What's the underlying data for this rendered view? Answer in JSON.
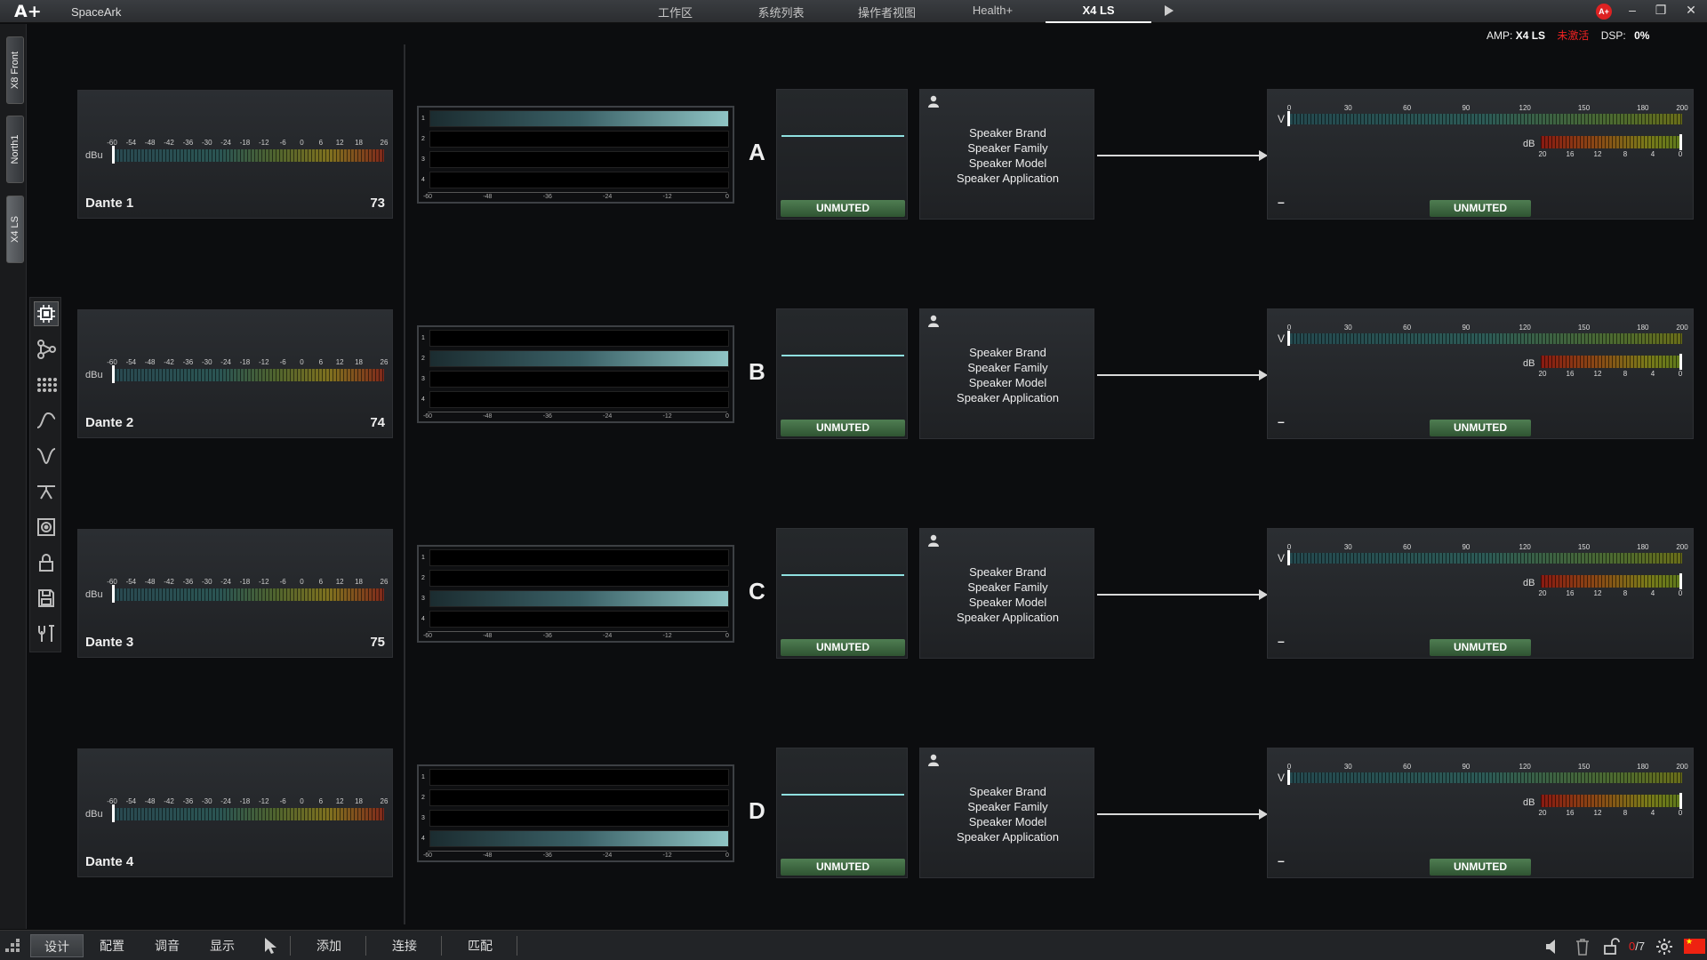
{
  "app": {
    "logo": "A+",
    "name": "SpaceArk"
  },
  "tabs": [
    "工作区",
    "系统列表",
    "操作者视图",
    "Health+",
    "X4 LS"
  ],
  "active_tab": "X4 LS",
  "brand_badge": "A+",
  "window_controls": {
    "minimize": "–",
    "restore": "❐",
    "close": "✕"
  },
  "amp_status": {
    "amp_label": "AMP:",
    "amp_value": "X4 LS",
    "activation": "未激活",
    "dsp_label": "DSP:",
    "dsp_value": "0%"
  },
  "device_tabs": [
    "X8 Front",
    "North1",
    "X4 LS"
  ],
  "tools": [
    "chip-icon",
    "routing-icon",
    "grid-icon",
    "curve-icon",
    "eq-icon",
    "filter-icon",
    "speaker-icon",
    "lock-icon",
    "save-icon",
    "tools-icon"
  ],
  "input_scale": [
    "-60",
    "-54",
    "-48",
    "-42",
    "-36",
    "-30",
    "-24",
    "-18",
    "-12",
    "-6",
    "0",
    "6",
    "12",
    "18",
    "26"
  ],
  "input_unit": "dBu",
  "matrix_scale": [
    "-60",
    "-48",
    "-36",
    "-24",
    "-12",
    "0"
  ],
  "matrix_rows": [
    "1",
    "2",
    "3",
    "4"
  ],
  "volt_unit": "V",
  "volt_scale": [
    "0",
    "30",
    "60",
    "90",
    "120",
    "150",
    "180",
    "200"
  ],
  "db_unit": "dB",
  "db_scale": [
    "20",
    "16",
    "12",
    "8",
    "4",
    "0"
  ],
  "speaker_lines": [
    "Speaker Brand",
    "Speaker Family",
    "Speaker Model",
    "Speaker Application"
  ],
  "channels": [
    {
      "input_name": "Dante 1",
      "input_number": "73",
      "letter": "A",
      "active_route": 1,
      "mute_state": "UNMUTED",
      "out_state": "UNMUTED",
      "out_minus": "–"
    },
    {
      "input_name": "Dante 2",
      "input_number": "74",
      "letter": "B",
      "active_route": 2,
      "mute_state": "UNMUTED",
      "out_state": "UNMUTED",
      "out_minus": "–"
    },
    {
      "input_name": "Dante 3",
      "input_number": "75",
      "letter": "C",
      "active_route": 3,
      "mute_state": "UNMUTED",
      "out_state": "UNMUTED",
      "out_minus": "–"
    },
    {
      "input_name": "Dante 4",
      "input_number": "",
      "letter": "D",
      "active_route": 4,
      "mute_state": "UNMUTED",
      "out_state": "UNMUTED",
      "out_minus": "–"
    }
  ],
  "bottom": {
    "modes": [
      "设计",
      "配置",
      "调音",
      "显示"
    ],
    "active_mode": "设计",
    "actions": [
      "添加",
      "连接",
      "匹配"
    ],
    "count_current": "0",
    "count_total": "/7"
  },
  "colors": {
    "accent_cyan": "#8fe0e0",
    "unmuted_green": "#4f7d52",
    "alert_red": "#e22222"
  }
}
